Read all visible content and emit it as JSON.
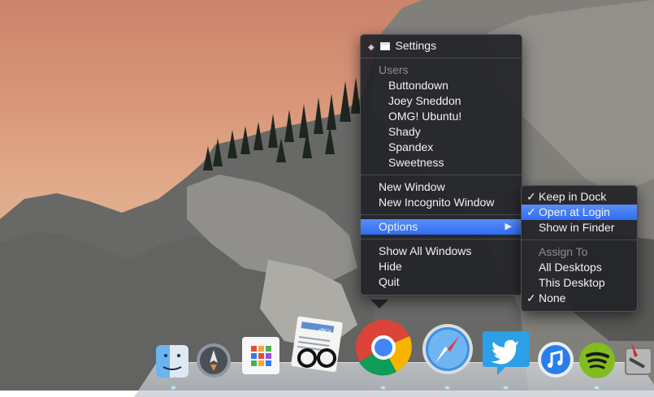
{
  "app_menu": {
    "settings": "Settings",
    "users_header": "Users",
    "users": [
      "Buttondown",
      "Joey Sneddon",
      "OMG! Ubuntu!",
      "Shady",
      "Spandex",
      "Sweetness"
    ],
    "new_window": "New Window",
    "new_incognito": "New Incognito Window",
    "options": "Options",
    "show_all_windows": "Show All Windows",
    "hide": "Hide",
    "quit": "Quit"
  },
  "options_submenu": {
    "keep_in_dock": "Keep in Dock",
    "open_at_login": "Open at Login",
    "show_in_finder": "Show in Finder",
    "assign_to_header": "Assign To",
    "all_desktops": "All Desktops",
    "this_desktop": "This Desktop",
    "none": "None",
    "checked": [
      "Keep in Dock",
      "Open at Login",
      "None"
    ],
    "highlighted": "Open at Login"
  },
  "dock": {
    "apps": [
      "finder-icon",
      "launchpad-icon",
      "app-grid-icon",
      "readkit-icon",
      "chrome-icon",
      "safari-icon",
      "twitter-icon",
      "itunes-icon",
      "spotify-icon",
      "script-app-icon"
    ],
    "readkit_label": "dKit"
  },
  "colors": {
    "menu_bg": "#222428",
    "highlight": "#3b78f4"
  }
}
